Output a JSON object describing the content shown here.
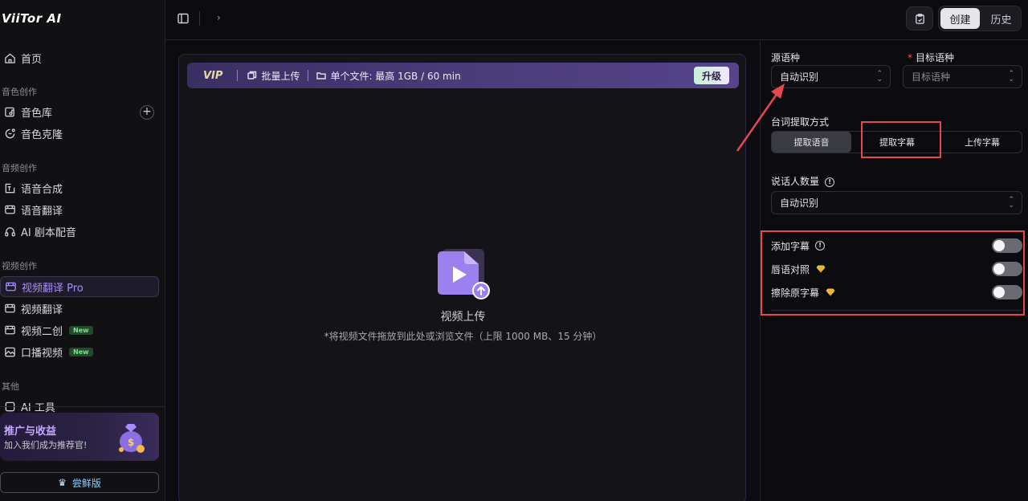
{
  "app": {
    "logo": "ViiTor AI"
  },
  "sidebar": {
    "home": "首页",
    "sections": [
      {
        "label": "音色创作",
        "items": [
          {
            "label": "音色库",
            "icon": "voice-library-icon"
          },
          {
            "label": "音色克隆",
            "icon": "voice-clone-icon"
          }
        ]
      },
      {
        "label": "音频创作",
        "items": [
          {
            "label": "语音合成",
            "icon": "tts-icon"
          },
          {
            "label": "语音翻译",
            "icon": "speech-translate-icon"
          },
          {
            "label": "AI 剧本配音",
            "icon": "headset-icon"
          }
        ]
      },
      {
        "label": "视频创作",
        "items": [
          {
            "label": "视频翻译 Pro",
            "icon": "video-translate-icon",
            "active": true
          },
          {
            "label": "视频翻译",
            "icon": "video-translate-icon"
          },
          {
            "label": "视频二创",
            "icon": "video-remix-icon",
            "badge": "New"
          },
          {
            "label": "口播视频",
            "icon": "image-icon",
            "badge": "New"
          }
        ]
      },
      {
        "label": "其他",
        "items": [
          {
            "label": "AI 工具",
            "icon": "tool-icon"
          }
        ]
      }
    ],
    "promo": {
      "title": "推广与收益",
      "subtitle": "加入我们成为推荐官!"
    },
    "trial_label": "尝鲜版"
  },
  "topbar": {
    "tabs": {
      "create": "创建",
      "history": "历史"
    }
  },
  "main": {
    "vip": {
      "logo": "VIP",
      "batch_upload": "批量上传",
      "file_limit": "单个文件: 最高 1GB / 60 min",
      "upgrade": "升级"
    },
    "upload": {
      "title": "视频上传",
      "hint": "*将视频文件拖放到此处或浏览文件（上限 1000 MB、15 分钟）"
    }
  },
  "right_panel": {
    "source_language": {
      "label": "源语种",
      "value": "自动识别"
    },
    "target_language": {
      "label": "目标语种",
      "required_mark": "*",
      "placeholder": "目标语种"
    },
    "extraction": {
      "label": "台词提取方式",
      "options": [
        "提取语音",
        "提取字幕",
        "上传字幕"
      ],
      "selected": "提取语音"
    },
    "speaker_count": {
      "label": "说话人数量",
      "value": "自动识别"
    },
    "toggles": [
      {
        "label": "添加字幕",
        "info": true,
        "premium": false,
        "enabled": false
      },
      {
        "label": "唇语对照",
        "info": false,
        "premium": true,
        "enabled": false
      },
      {
        "label": "擦除原字幕",
        "info": false,
        "premium": true,
        "enabled": false
      }
    ]
  },
  "colors": {
    "accent": "#a98cff",
    "annotation": "#e5484d",
    "vip_bar": "#4a3b7a",
    "new_badge": "#7fe08a"
  }
}
